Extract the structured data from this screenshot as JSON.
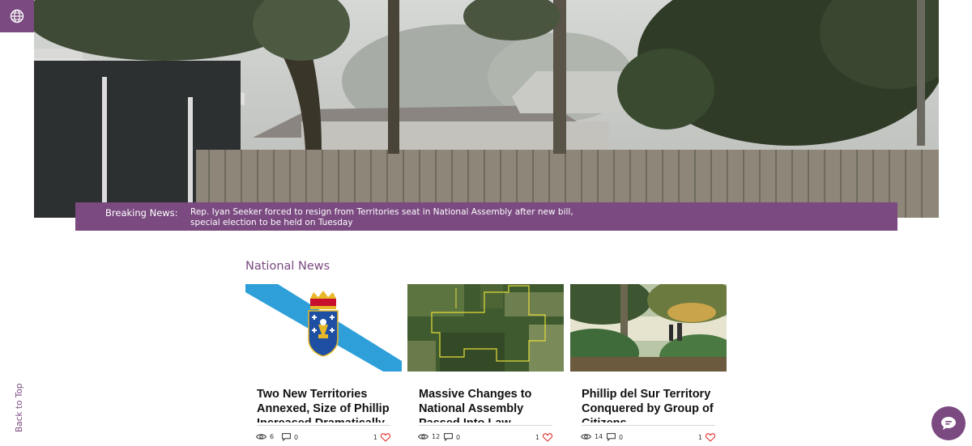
{
  "breaking": {
    "label": "Breaking News:",
    "text": "Rep. Iyan Seeker forced to resign from Territories seat in National Assembly after new bill, special election to be held on Tuesday"
  },
  "section": {
    "title": "National News"
  },
  "posts": [
    {
      "title": "Two New Territories Annexed, Size of Phillip Increased Dramatically",
      "views": "6",
      "comments": "0",
      "likes": "1"
    },
    {
      "title": "Massive Changes to National Assembly Passed Into Law",
      "views": "12",
      "comments": "0",
      "likes": "1"
    },
    {
      "title": "Phillip del Sur Territory Conquered by Group of Citizens",
      "views": "14",
      "comments": "0",
      "likes": "1"
    }
  ],
  "back_to_top": "Back to Top",
  "icons": {
    "globe": "globe-icon",
    "chat": "chat-icon",
    "views": "eye-icon",
    "comments": "comment-icon",
    "likes": "heart-icon"
  },
  "colors": {
    "accent": "#7a4a80",
    "like": "#e0332f",
    "flag_blue": "#2e9fd8"
  }
}
